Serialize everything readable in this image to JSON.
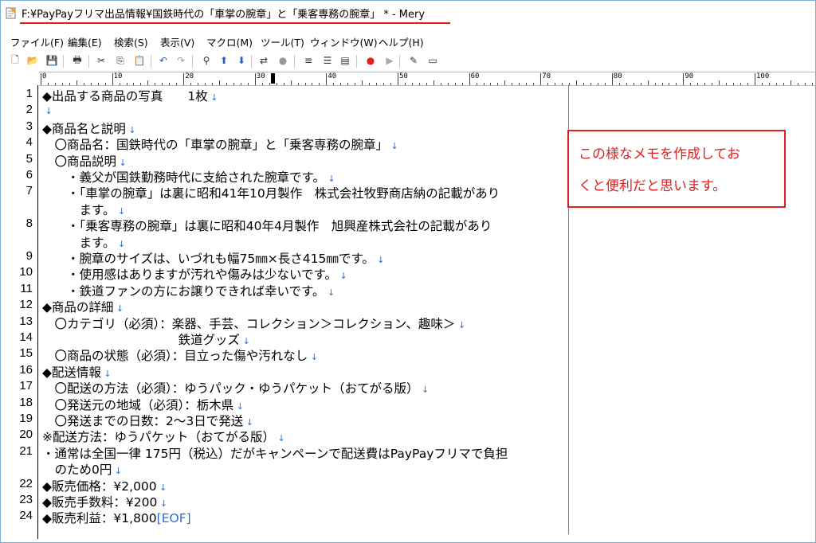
{
  "window": {
    "title": "F:¥PayPayフリマ出品情報¥国鉄時代の「車掌の腕章」と「乗客専務の腕章」 * - Mery"
  },
  "menu": [
    {
      "label": "ファイル(F)"
    },
    {
      "label": "編集(E)"
    },
    {
      "label": "検索(S)"
    },
    {
      "label": "表示(V)"
    },
    {
      "label": "マクロ(M)"
    },
    {
      "label": "ツール(T)"
    },
    {
      "label": "ウィンドウ(W)"
    },
    {
      "label": "ヘルプ(H)"
    }
  ],
  "toolbar": [
    {
      "icon": "new-file-icon"
    },
    {
      "icon": "open-folder-icon"
    },
    {
      "icon": "save-icon"
    },
    {
      "icon": "print-icon"
    },
    {
      "icon": "cut-icon"
    },
    {
      "icon": "copy-icon"
    },
    {
      "icon": "paste-icon"
    },
    {
      "icon": "undo-icon"
    },
    {
      "icon": "redo-icon"
    },
    {
      "icon": "find-icon"
    },
    {
      "icon": "find-up-icon"
    },
    {
      "icon": "find-down-icon"
    },
    {
      "icon": "replace-icon"
    },
    {
      "icon": "mark-icon"
    },
    {
      "icon": "wrap-none-icon"
    },
    {
      "icon": "wrap-window-icon"
    },
    {
      "icon": "wrap-ruler-icon"
    },
    {
      "icon": "record-icon"
    },
    {
      "icon": "play-icon"
    },
    {
      "icon": "pin-icon"
    },
    {
      "icon": "window-icon"
    }
  ],
  "ruler": {
    "labels": [
      "0",
      "10",
      "20",
      "30",
      "40",
      "50",
      "60",
      "70",
      "80",
      "90",
      "100"
    ]
  },
  "lines": [
    {
      "num": "1",
      "text": "◆出品する商品の写真　　1枚",
      "eol": true
    },
    {
      "num": "2",
      "text": "",
      "eol": true
    },
    {
      "num": "3",
      "text": "◆商品名と説明",
      "eol": true
    },
    {
      "num": "4",
      "text": "　〇商品名：国鉄時代の「車掌の腕章」と「乗客専務の腕章」",
      "eol": true
    },
    {
      "num": "5",
      "text": "　〇商品説明",
      "eol": true
    },
    {
      "num": "6",
      "text": "　　・義父が国鉄勤務時代に支給された腕章です。",
      "eol": true
    },
    {
      "num": "7",
      "text": "　　・「車掌の腕章」は裏に昭和41年10月製作　株式会社牧野商店納の記載があり",
      "eol": false
    },
    {
      "num": "",
      "text": "　　　ます。",
      "eol": true
    },
    {
      "num": "8",
      "text": "　　・「乗客専務の腕章」は裏に昭和40年4月製作　旭興産株式会社の記載があり",
      "eol": false
    },
    {
      "num": "",
      "text": "　　　ます。",
      "eol": true
    },
    {
      "num": "9",
      "text": "　　・腕章のサイズは、いづれも幅75㎜×長さ415㎜です。",
      "eol": true
    },
    {
      "num": "10",
      "text": "　　・使用感はありますが汚れや傷みは少ないです。",
      "eol": true
    },
    {
      "num": "11",
      "text": "　　・鉄道ファンの方にお譲りできれば幸いです。",
      "eol": true
    },
    {
      "num": "12",
      "text": "◆商品の詳細",
      "eol": true
    },
    {
      "num": "13",
      "text": "　〇カテゴリ（必須）：楽器、手芸、コレクション＞コレクション、趣味＞",
      "eol": true
    },
    {
      "num": "14",
      "text": "　　　　　　　　　　　鉄道グッズ",
      "eol": true
    },
    {
      "num": "15",
      "text": "　〇商品の状態（必須）：目立った傷や汚れなし",
      "eol": true
    },
    {
      "num": "16",
      "text": "◆配送情報",
      "eol": true
    },
    {
      "num": "17",
      "text": "　〇配送の方法（必須）：ゆうパック・ゆうパケット（おてがる版）",
      "eol": true
    },
    {
      "num": "18",
      "text": "　〇発送元の地域（必須）：栃木県",
      "eol": true
    },
    {
      "num": "19",
      "text": "　〇発送までの日数：2〜3日で発送",
      "eol": true
    },
    {
      "num": "20",
      "text": "※配送方法：ゆうパケット（おてがる版）",
      "eol": true
    },
    {
      "num": "21",
      "text": "・通常は全国一律 175円（税込）だがキャンペーンで配送費はPayPayフリマで負担",
      "eol": false
    },
    {
      "num": "",
      "text": "　のため0円",
      "eol": true
    },
    {
      "num": "22",
      "text": "◆販売価格：¥2,000",
      "eol": true
    },
    {
      "num": "23",
      "text": "◆販売手数料：¥200",
      "eol": true
    },
    {
      "num": "24",
      "text": "◆販売利益：¥1,800",
      "eol": false,
      "eof": "[EOF]"
    }
  ],
  "memo": {
    "line1": "この様なメモを作成してお",
    "line2": "くと便利だと思います。"
  },
  "colors": {
    "annotation_red": "#e02020",
    "eol_blue": "#2a6fd0",
    "wrap_guide": "#3aa0a0"
  }
}
